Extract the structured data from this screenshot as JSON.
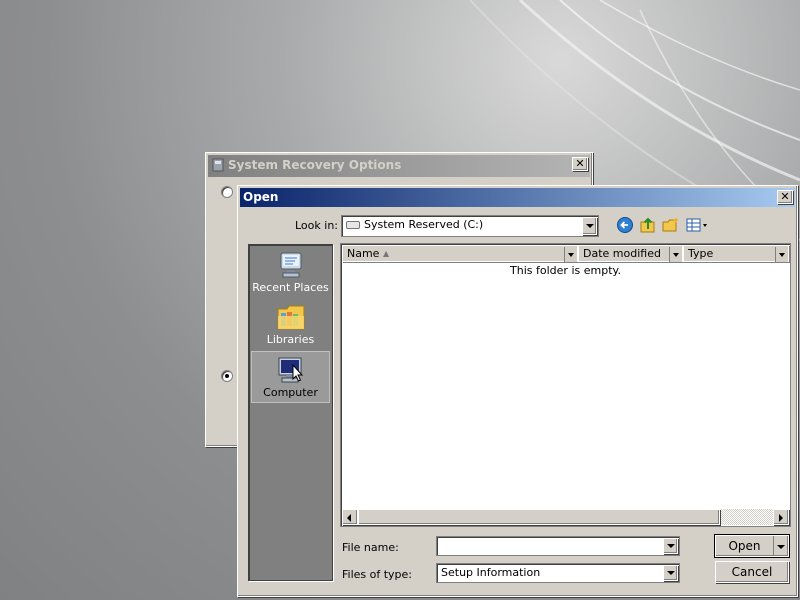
{
  "back_dialog": {
    "title": "System Recovery Options"
  },
  "open_dialog": {
    "title": "Open",
    "look_in_label": "Look in:",
    "look_in_value": "System Reserved (C:)",
    "toolbar_icons": [
      "back-arrow-icon",
      "up-folder-icon",
      "new-folder-icon",
      "view-menu-icon"
    ],
    "places": [
      {
        "label": "Recent Places",
        "icon": "recent-places-icon"
      },
      {
        "label": "Libraries",
        "icon": "libraries-icon"
      },
      {
        "label": "Computer",
        "icon": "computer-icon"
      }
    ],
    "columns": {
      "name": "Name",
      "date_modified": "Date modified",
      "type": "Type"
    },
    "empty_message": "This folder is empty.",
    "file_name_label": "File name:",
    "file_name_value": "",
    "files_of_type_label": "Files of type:",
    "files_of_type_value": "Setup Information",
    "open_button": "Open",
    "cancel_button": "Cancel"
  },
  "colors": {
    "title_active": "#0a246a",
    "title_inactive": "#808080",
    "face": "#d4d0c8"
  }
}
